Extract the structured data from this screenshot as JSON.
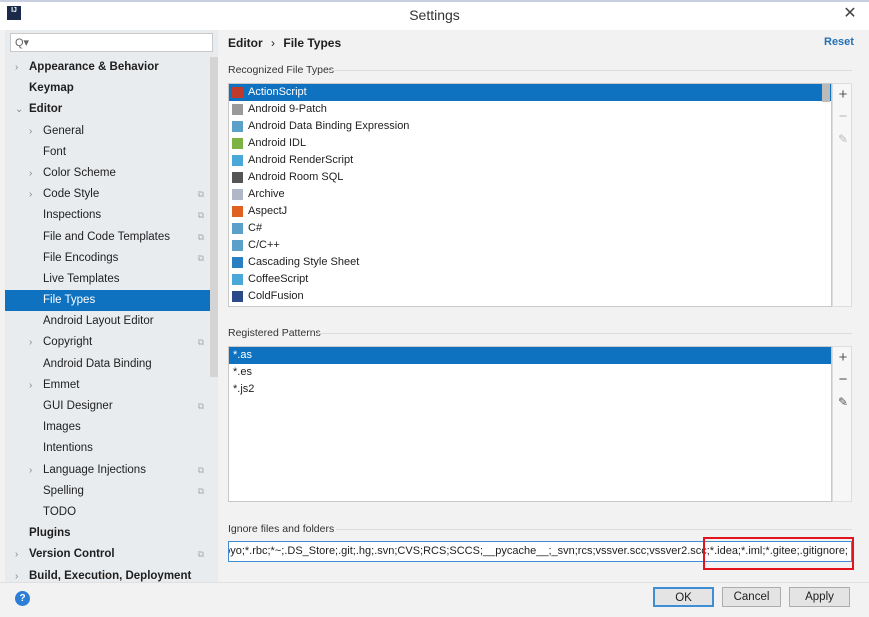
{
  "window": {
    "title": "Settings",
    "close": "✕",
    "logo": "IJ"
  },
  "search": {
    "placeholder": "Q▾"
  },
  "tree": [
    {
      "label": "Appearance & Behavior",
      "level": 0,
      "bold": true,
      "chevron": "›"
    },
    {
      "label": "Keymap",
      "level": 0,
      "bold": true
    },
    {
      "label": "Editor",
      "level": 0,
      "bold": true,
      "chevron": "⌄"
    },
    {
      "label": "General",
      "level": 1,
      "chevron": "›"
    },
    {
      "label": "Font",
      "level": 1
    },
    {
      "label": "Color Scheme",
      "level": 1,
      "chevron": "›"
    },
    {
      "label": "Code Style",
      "level": 1,
      "chevron": "›",
      "copy": true
    },
    {
      "label": "Inspections",
      "level": 1,
      "copy": true
    },
    {
      "label": "File and Code Templates",
      "level": 1,
      "copy": true
    },
    {
      "label": "File Encodings",
      "level": 1,
      "copy": true
    },
    {
      "label": "Live Templates",
      "level": 1
    },
    {
      "label": "File Types",
      "level": 1,
      "selected": true
    },
    {
      "label": "Android Layout Editor",
      "level": 1
    },
    {
      "label": "Copyright",
      "level": 1,
      "chevron": "›",
      "copy": true
    },
    {
      "label": "Android Data Binding",
      "level": 1
    },
    {
      "label": "Emmet",
      "level": 1,
      "chevron": "›"
    },
    {
      "label": "GUI Designer",
      "level": 1,
      "copy": true
    },
    {
      "label": "Images",
      "level": 1
    },
    {
      "label": "Intentions",
      "level": 1
    },
    {
      "label": "Language Injections",
      "level": 1,
      "chevron": "›",
      "copy": true
    },
    {
      "label": "Spelling",
      "level": 1,
      "copy": true
    },
    {
      "label": "TODO",
      "level": 1
    },
    {
      "label": "Plugins",
      "level": 0,
      "bold": true
    },
    {
      "label": "Version Control",
      "level": 0,
      "bold": true,
      "chevron": "›",
      "copy": true
    },
    {
      "label": "Build, Execution, Deployment",
      "level": 0,
      "bold": true,
      "chevron": "›"
    }
  ],
  "breadcrumb": {
    "parent": "Editor",
    "sep": "›",
    "current": "File Types"
  },
  "reset_label": "Reset",
  "recognized": {
    "label": "Recognized File Types",
    "items": [
      {
        "label": "ActionScript",
        "color": "#c0392b",
        "selected": true
      },
      {
        "label": "Android 9-Patch",
        "color": "#9a9a9a"
      },
      {
        "label": "Android Data Binding Expression",
        "color": "#5aa0c8"
      },
      {
        "label": "Android IDL",
        "color": "#7cb342"
      },
      {
        "label": "Android RenderScript",
        "color": "#4aa8d8"
      },
      {
        "label": "Android Room SQL",
        "color": "#555555"
      },
      {
        "label": "Archive",
        "color": "#b0b8c8"
      },
      {
        "label": "AspectJ",
        "color": "#e06020"
      },
      {
        "label": "C#",
        "color": "#5aa0c8"
      },
      {
        "label": "C/C++",
        "color": "#5aa0c8"
      },
      {
        "label": "Cascading Style Sheet",
        "color": "#2a7fc0"
      },
      {
        "label": "CoffeeScript",
        "color": "#4aa8d8"
      },
      {
        "label": "ColdFusion",
        "color": "#2a4a8a"
      }
    ]
  },
  "patterns": {
    "label": "Registered Patterns",
    "items": [
      {
        "label": "*.as",
        "selected": true
      },
      {
        "label": "*.es"
      },
      {
        "label": "*.js2"
      }
    ]
  },
  "toolbar": {
    "add": "+",
    "remove": "−",
    "edit": "✎"
  },
  "ignore": {
    "label": "Ignore files and folders",
    "value": "pyc;*.pyo;*.rbc;*~;.DS_Store;.git;.hg;.svn;CVS;RCS;SCCS;__pycache__;_svn;rcs;vssver.scc;vssver2.scc;*.idea;*.iml;*.gitee;.gitignore;"
  },
  "buttons": {
    "ok": "OK",
    "cancel": "Cancel",
    "apply": "Apply",
    "help": "?"
  },
  "colors": {
    "accent": "#0f72c0",
    "highlight": "#e2141c",
    "link": "#2470b3"
  }
}
